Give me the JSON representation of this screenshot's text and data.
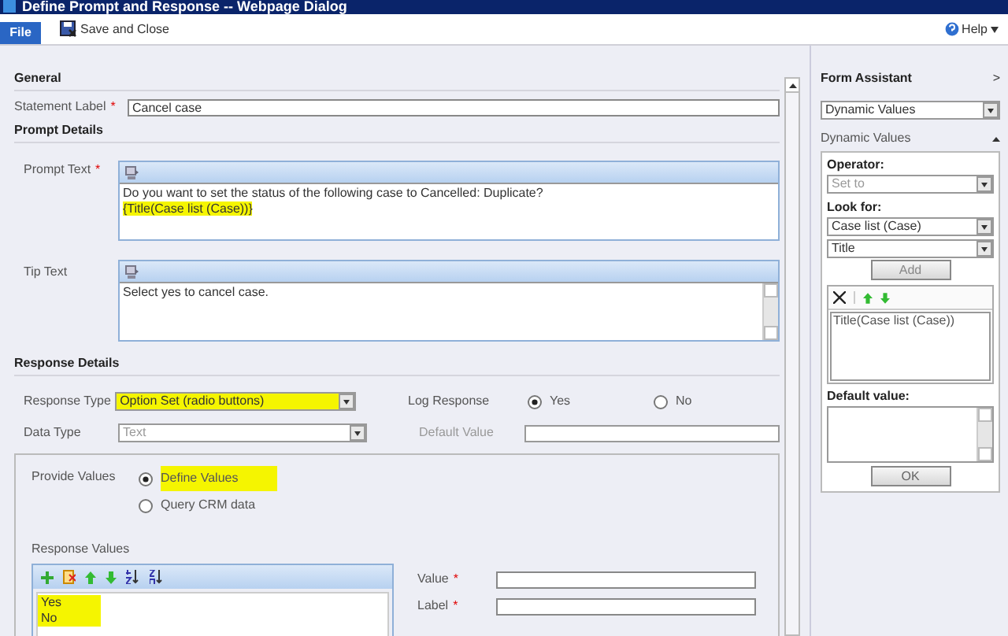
{
  "window": {
    "title": "Define Prompt and Response -- Webpage Dialog"
  },
  "toolbar": {
    "file_tab": "File",
    "save_close": "Save and Close",
    "help": "Help"
  },
  "general": {
    "heading": "General",
    "statement_label": {
      "label": "Statement Label",
      "required_mark": "*",
      "value": "Cancel case"
    }
  },
  "prompt_details": {
    "heading": "Prompt Details",
    "prompt_text": {
      "label": "Prompt Text",
      "required_mark": "*",
      "lines": [
        {
          "text": "Do you want to set the status of the following case to Cancelled: Duplicate?",
          "highlighted": false
        },
        {
          "text": "{Title(Case list (Case))}",
          "highlighted": true
        }
      ]
    },
    "tip_text": {
      "label": "Tip Text",
      "lines": [
        {
          "text": "Select yes to cancel case.",
          "highlighted": false
        }
      ]
    }
  },
  "response_details": {
    "heading": "Response Details",
    "response_type": {
      "label": "Response Type",
      "value": "Option Set (radio buttons)",
      "highlighted": true,
      "disabled": false
    },
    "log_response": {
      "label": "Log Response",
      "options": [
        {
          "label": "Yes",
          "selected": true
        },
        {
          "label": "No",
          "selected": false
        }
      ]
    },
    "data_type": {
      "label": "Data Type",
      "value": "Text",
      "highlighted": false,
      "disabled": true
    },
    "default_value": {
      "label": "Default Value",
      "disabled": true
    },
    "provide_values": {
      "label": "Provide Values",
      "options": [
        {
          "label": "Define Values",
          "selected": true,
          "highlighted": true
        },
        {
          "label": "Query CRM data",
          "selected": false,
          "highlighted": false
        }
      ]
    },
    "response_values": {
      "label": "Response Values",
      "items": [
        {
          "text": "Yes",
          "highlighted": true
        },
        {
          "text": "No",
          "highlighted": true
        }
      ]
    },
    "value_field": {
      "label": "Value",
      "required_mark": "*"
    },
    "label_field": {
      "label": "Label",
      "required_mark": "*"
    }
  },
  "form_assistant": {
    "title": "Form Assistant",
    "expand": ">",
    "selector": "Dynamic Values",
    "section": "Dynamic Values",
    "operator": {
      "label": "Operator:",
      "value": "Set to"
    },
    "look_for": {
      "label": "Look for:",
      "value": "Case list (Case)",
      "attribute": "Title"
    },
    "add_button": "Add",
    "values": [
      "Title(Case list (Case))"
    ],
    "default_value": {
      "label": "Default value:"
    },
    "ok_button": "OK"
  }
}
